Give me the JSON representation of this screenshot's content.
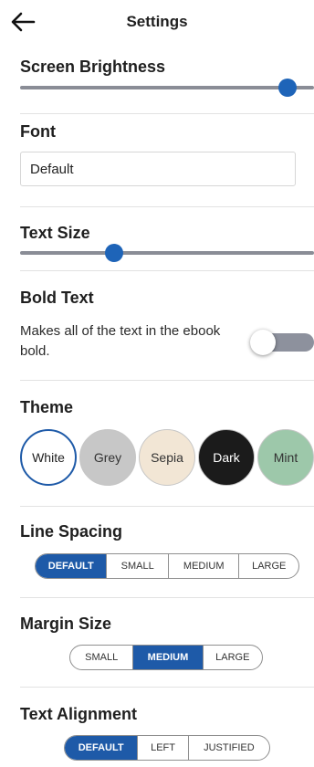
{
  "header": {
    "title": "Settings",
    "back_icon": "arrow-left-icon"
  },
  "brightness": {
    "label": "Screen Brightness",
    "value": 0.91
  },
  "font": {
    "label": "Font",
    "value": "Default"
  },
  "text_size": {
    "label": "Text Size",
    "value": 0.32
  },
  "bold_text": {
    "label": "Bold Text",
    "description": "Makes all of the text in the ebook bold.",
    "enabled": false
  },
  "theme": {
    "label": "Theme",
    "options": [
      {
        "name": "White",
        "bg": "#ffffff",
        "fg": "#222222",
        "selected": true
      },
      {
        "name": "Grey",
        "bg": "#c7c7c7",
        "fg": "#333333",
        "selected": false
      },
      {
        "name": "Sepia",
        "bg": "#f2e6d5",
        "fg": "#333333",
        "selected": false
      },
      {
        "name": "Dark",
        "bg": "#1b1b1b",
        "fg": "#ffffff",
        "selected": false
      },
      {
        "name": "Mint",
        "bg": "#9dc8aa",
        "fg": "#333333",
        "selected": false
      }
    ]
  },
  "line_spacing": {
    "label": "Line Spacing",
    "options": [
      "DEFAULT",
      "SMALL",
      "MEDIUM",
      "LARGE"
    ],
    "selected": "DEFAULT"
  },
  "margin_size": {
    "label": "Margin Size",
    "options": [
      "SMALL",
      "MEDIUM",
      "LARGE"
    ],
    "selected": "MEDIUM"
  },
  "text_alignment": {
    "label": "Text Alignment",
    "options": [
      "DEFAULT",
      "LEFT",
      "JUSTIFIED"
    ],
    "selected": "DEFAULT"
  },
  "colors": {
    "accent": "#1e5aa8",
    "slider_thumb": "#1e64b8",
    "slider_track": "#8a8d96"
  }
}
